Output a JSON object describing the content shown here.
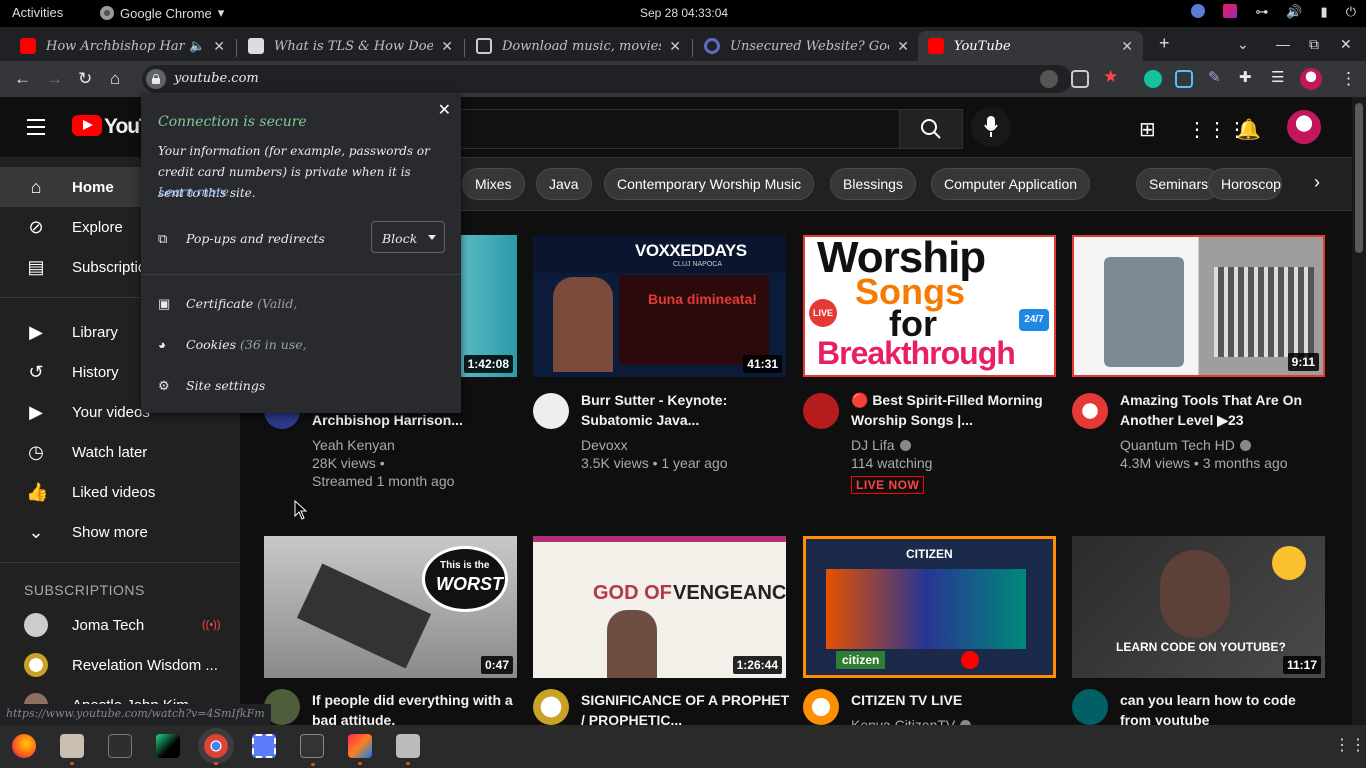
{
  "topbar": {
    "activities": "Activities",
    "app_name": "Google Chrome",
    "clock": "Sep 28  04:33:04"
  },
  "tabs": [
    {
      "title": "How Archbishop Harrison",
      "active": false
    },
    {
      "title": "What is TLS & How Does it",
      "active": false
    },
    {
      "title": "Download music, movies, gam",
      "active": false
    },
    {
      "title": "Unsecured Website? Google Se",
      "active": false
    },
    {
      "title": "YouTube",
      "active": true
    }
  ],
  "toolbar": {
    "url": "youtube.com"
  },
  "popup": {
    "title": "Connection is secure",
    "description": "Your information (for example, passwords or credit card numbers) is private when it is sent to this site.",
    "learn_more": "Learn more",
    "popups_label": "Pop-ups and redirects",
    "popups_value": "Block",
    "certificate_label": "Certificate",
    "certificate_sub": "(Valid,",
    "cookies_label": "Cookies",
    "cookies_sub": "(36 in use,",
    "site_settings": "Site settings"
  },
  "youtube": {
    "logo_text": "YouTube",
    "sidebar": [
      {
        "label": "Home",
        "icon": "home-icon",
        "glyph": "⌂"
      },
      {
        "label": "Explore",
        "icon": "explore-icon",
        "glyph": "⊘"
      },
      {
        "label": "Subscriptions",
        "icon": "subscriptions-icon",
        "glyph": "▤"
      },
      {
        "label": "Library",
        "icon": "library-icon",
        "glyph": "▶"
      },
      {
        "label": "History",
        "icon": "history-icon",
        "glyph": "↺"
      },
      {
        "label": "Your videos",
        "icon": "your-videos-icon",
        "glyph": "▶"
      },
      {
        "label": "Watch later",
        "icon": "watch-later-icon",
        "glyph": "◷"
      },
      {
        "label": "Liked videos",
        "icon": "liked-icon",
        "glyph": "👍"
      },
      {
        "label": "Show more",
        "icon": "chevron-down-icon",
        "glyph": "⌄"
      }
    ],
    "subscriptions_heading": "SUBSCRIPTIONS",
    "subscriptions": [
      {
        "name": "Joma Tech"
      },
      {
        "name": "Revelation Wisdom ..."
      },
      {
        "name": "Apostle John Kim..."
      }
    ],
    "chips": [
      "Mixes",
      "Java",
      "Contemporary Worship Music",
      "Blessings",
      "Computer Application",
      "Seminars",
      "Horoscope"
    ],
    "videos": [
      {
        "title_line2": "Archbishop Harrison...",
        "channel": "Yeah Kenyan",
        "meta1": "28K views •",
        "meta2": "Streamed 1 month ago",
        "duration": "1:42:08"
      },
      {
        "title": "Burr Sutter - Keynote: Subatomic Java...",
        "channel": "Devoxx",
        "meta1": "3.5K views • 1 year ago",
        "duration": "41:31",
        "thumb_text": "VOXXEDDAYS",
        "thumb_sub": "CLUJ NAPOCA",
        "thumb_text2": "Buna dimineata!"
      },
      {
        "title": "🔴 Best Spirit-Filled Morning Worship Songs |...",
        "channel": "DJ Lifa",
        "meta1": "114 watching",
        "live": "LIVE NOW",
        "thumb_text": "Worship",
        "thumb_text2": "Songs",
        "thumb_text3": "for",
        "thumb_text4": "Breakthrough",
        "thumb_badge": "LIVE",
        "thumb_clock": "24/7"
      },
      {
        "title": "Amazing Tools That Are On Another Level ▶23",
        "channel": "Quantum Tech HD",
        "meta1": "4.3M views • 3 months ago",
        "duration": "9:11"
      },
      {
        "title": "If people did everything with a bad attitude.",
        "duration": "0:47",
        "thumb_text": "This is the",
        "thumb_text2": "WORST"
      },
      {
        "title": "SIGNIFICANCE OF A PROPHET / PROPHETIC...",
        "duration": "1:26:44",
        "thumb_text": "GOD OF",
        "thumb_text2": "VENGEANCE"
      },
      {
        "title": "CITIZEN TV LIVE",
        "channel": "Kenya CitizenTV",
        "thumb_text": "CITIZEN",
        "thumb_text2": "citizen"
      },
      {
        "title": "can you learn how to code from youtube",
        "duration": "11:17",
        "thumb_text": "LEARN CODE ON YOUTUBE?"
      }
    ]
  },
  "status_url": "https://www.youtube.com/watch?v=4SmIfkFm",
  "colors": {
    "yt_red": "#ff0000",
    "secure_green": "#81c995",
    "link_blue": "#8ab4f8",
    "dock_accent": "#e95420"
  }
}
